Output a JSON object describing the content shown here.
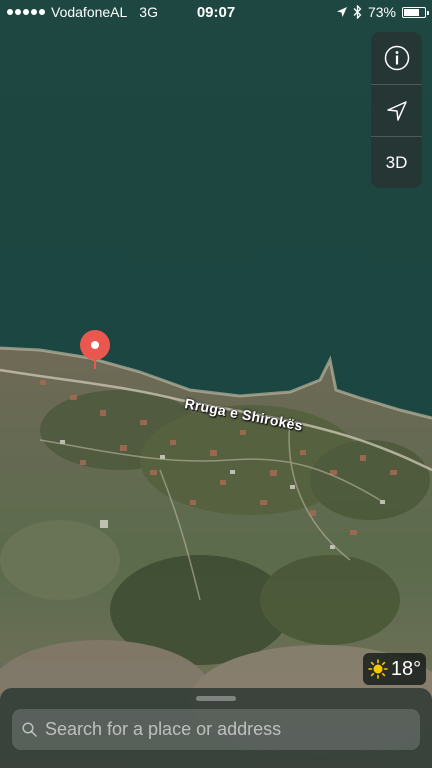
{
  "status_bar": {
    "signal_bars": 5,
    "carrier": "VodafoneAL",
    "network": "3G",
    "time": "09:07",
    "battery_percent": "73%",
    "battery_level": 0.73
  },
  "map": {
    "road_label": "Rruga e Shirokës"
  },
  "controls": {
    "info_icon": "info-icon",
    "location_icon": "location-arrow-icon",
    "view_3d_label": "3D"
  },
  "weather": {
    "icon": "sun-icon",
    "temperature": "18°"
  },
  "search": {
    "placeholder": "Search for a place or address"
  },
  "colors": {
    "water": "#1f4a44",
    "pin": "#e9574e",
    "land": "#5d6b52"
  }
}
